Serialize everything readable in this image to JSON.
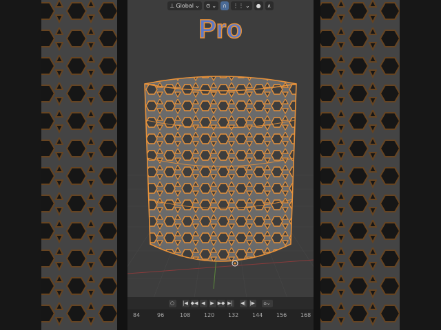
{
  "header": {
    "orientation_label": "Global",
    "orientation_icon": "transform-orientation-icon",
    "pivot_icon": "pivot-point-icon",
    "snap_icon": "magnet-icon",
    "snap_target_icon": "snap-increment-icon",
    "proportional_icon": "proportional-edit-icon",
    "falloff_icon": "falloff-curve-icon"
  },
  "overlay_title": "Pro",
  "timeline": {
    "controls": [
      "record",
      "jump-start",
      "prev-keyframe",
      "play-reverse",
      "play",
      "next-keyframe",
      "jump-end",
      "prev-marker",
      "next-marker",
      "keying"
    ],
    "frame_ticks": [
      "84",
      "96",
      "108",
      "120",
      "132",
      "144",
      "156",
      "168"
    ]
  },
  "colors": {
    "viewport_bg": "#3d3d3d",
    "lattice_orange": "#e8923a",
    "title_blue": "#5b79c8",
    "grid_red_axis": "#8a3b3b",
    "grid_green_axis": "#5c8a3c"
  }
}
